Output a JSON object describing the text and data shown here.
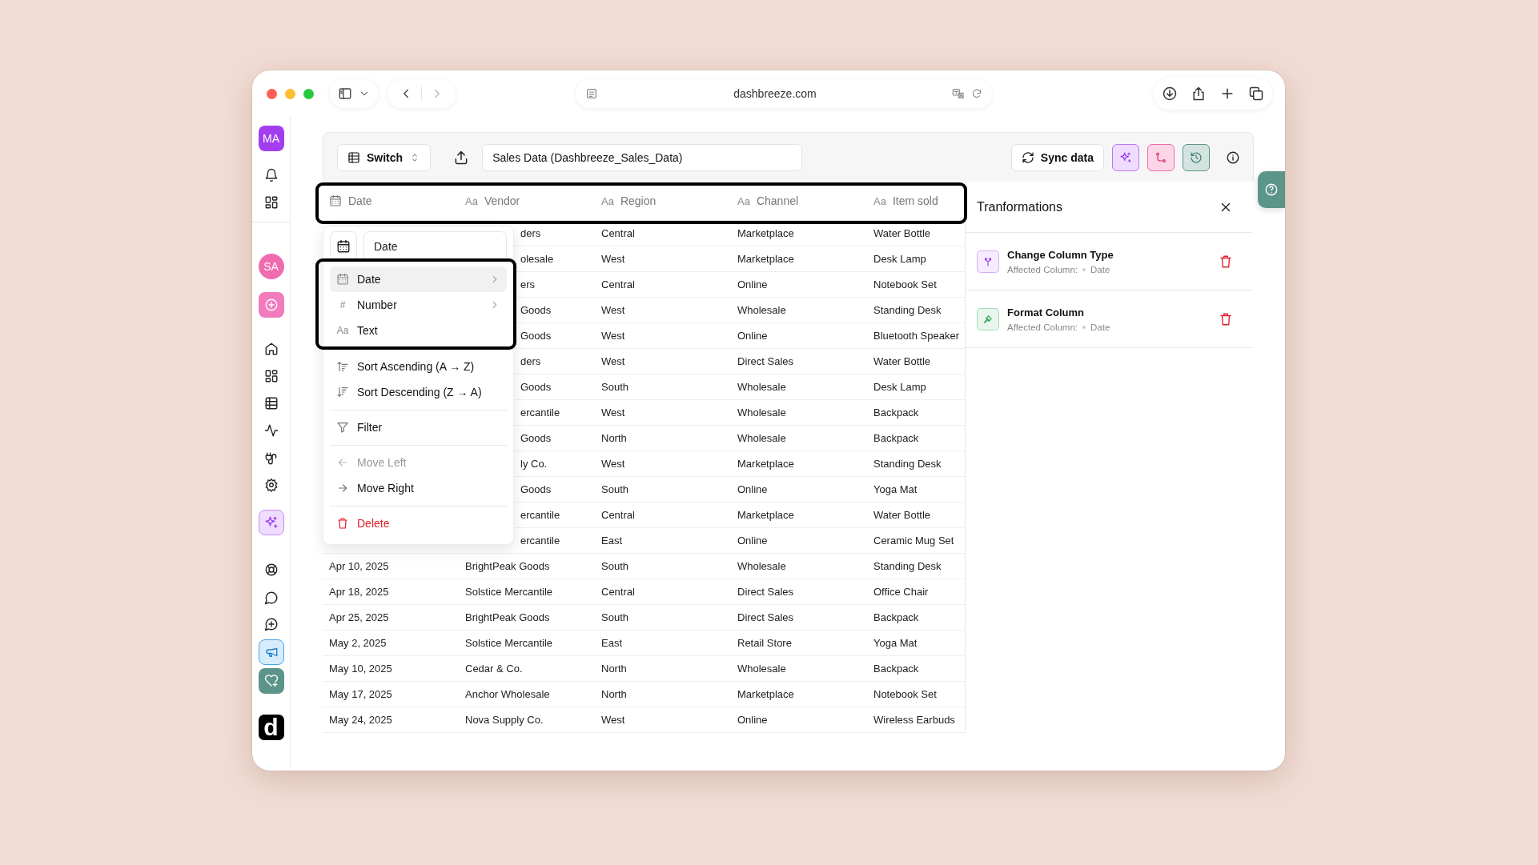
{
  "browser": {
    "url": "dashbreeze.com"
  },
  "sidebar": {
    "user_avatar": "MA",
    "workspace_avatar": "SA",
    "logo": "d"
  },
  "toolbar": {
    "switch_label": "Switch",
    "dataset_name": "Sales Data (Dashbreeze_Sales_Data)",
    "sync_label": "Sync data"
  },
  "table": {
    "columns": [
      {
        "label": "Date",
        "kind": "date"
      },
      {
        "label": "Vendor",
        "kind": "text",
        "glyph": "Aa"
      },
      {
        "label": "Region",
        "kind": "text",
        "glyph": "Aa"
      },
      {
        "label": "Channel",
        "kind": "text",
        "glyph": "Aa"
      },
      {
        "label": "Item sold",
        "kind": "text",
        "glyph": "Aa"
      }
    ],
    "rows": [
      {
        "vendor": "ders",
        "region": "Central",
        "channel": "Marketplace",
        "item": "Water Bottle"
      },
      {
        "vendor": "olesale",
        "region": "West",
        "channel": "Marketplace",
        "item": "Desk Lamp"
      },
      {
        "vendor": "ers",
        "region": "Central",
        "channel": "Online",
        "item": "Notebook Set"
      },
      {
        "vendor": "Goods",
        "region": "West",
        "channel": "Wholesale",
        "item": "Standing Desk"
      },
      {
        "vendor": "Goods",
        "region": "West",
        "channel": "Online",
        "item": "Bluetooth Speaker"
      },
      {
        "vendor": "ders",
        "region": "West",
        "channel": "Direct Sales",
        "item": "Water Bottle"
      },
      {
        "vendor": "Goods",
        "region": "South",
        "channel": "Wholesale",
        "item": "Desk Lamp"
      },
      {
        "vendor": "ercantile",
        "region": "West",
        "channel": "Wholesale",
        "item": "Backpack"
      },
      {
        "vendor": "Goods",
        "region": "North",
        "channel": "Wholesale",
        "item": "Backpack"
      },
      {
        "vendor": "ly Co.",
        "region": "West",
        "channel": "Marketplace",
        "item": "Standing Desk"
      },
      {
        "vendor": "Goods",
        "region": "South",
        "channel": "Online",
        "item": "Yoga Mat"
      },
      {
        "vendor": "ercantile",
        "region": "Central",
        "channel": "Marketplace",
        "item": "Water Bottle"
      },
      {
        "vendor": "ercantile",
        "region": "East",
        "channel": "Online",
        "item": "Ceramic Mug Set"
      },
      {
        "date": "Apr 10, 2025",
        "vendor": "BrightPeak Goods",
        "region": "South",
        "channel": "Wholesale",
        "item": "Standing Desk"
      },
      {
        "date": "Apr 18, 2025",
        "vendor": "Solstice Mercantile",
        "region": "Central",
        "channel": "Direct Sales",
        "item": "Office Chair"
      },
      {
        "date": "Apr 25, 2025",
        "vendor": "BrightPeak Goods",
        "region": "South",
        "channel": "Direct Sales",
        "item": "Backpack"
      },
      {
        "date": "May 2, 2025",
        "vendor": "Solstice Mercantile",
        "region": "East",
        "channel": "Retail Store",
        "item": "Yoga Mat"
      },
      {
        "date": "May 10, 2025",
        "vendor": "Cedar & Co.",
        "region": "North",
        "channel": "Wholesale",
        "item": "Backpack"
      },
      {
        "date": "May 17, 2025",
        "vendor": "Anchor Wholesale",
        "region": "North",
        "channel": "Marketplace",
        "item": "Notebook Set"
      },
      {
        "date": "May 24, 2025",
        "vendor": "Nova Supply Co.",
        "region": "West",
        "channel": "Online",
        "item": "Wireless Earbuds"
      }
    ]
  },
  "column_menu": {
    "name_field": {
      "value": "Date"
    },
    "type_options": [
      {
        "label": "Date",
        "selected": true,
        "submenu": true
      },
      {
        "label": "Number",
        "glyph": "#",
        "selected": false,
        "submenu": true
      },
      {
        "label": "Text",
        "glyph": "Aa",
        "selected": false,
        "submenu": false
      }
    ],
    "action_groups": [
      [
        {
          "label": "Sort Ascending (A → Z)",
          "kind": "normal",
          "disabled": false
        },
        {
          "label": "Sort Descending (Z → A)",
          "kind": "normal",
          "disabled": false
        }
      ],
      [
        {
          "label": "Filter",
          "kind": "normal",
          "disabled": false
        }
      ],
      [
        {
          "label": "Move Left",
          "kind": "normal",
          "disabled": true
        },
        {
          "label": "Move Right",
          "kind": "normal",
          "disabled": false
        }
      ],
      [
        {
          "label": "Delete",
          "kind": "danger",
          "disabled": false
        }
      ]
    ]
  },
  "transformations": {
    "title": "Tranformations",
    "items": [
      {
        "title": "Change Column Type",
        "affected_label": "Affected Column:",
        "column": "Date",
        "color": "#9333ea"
      },
      {
        "title": "Format Column",
        "affected_label": "Affected Column:",
        "column": "Date",
        "color": "#16a34a"
      }
    ]
  }
}
